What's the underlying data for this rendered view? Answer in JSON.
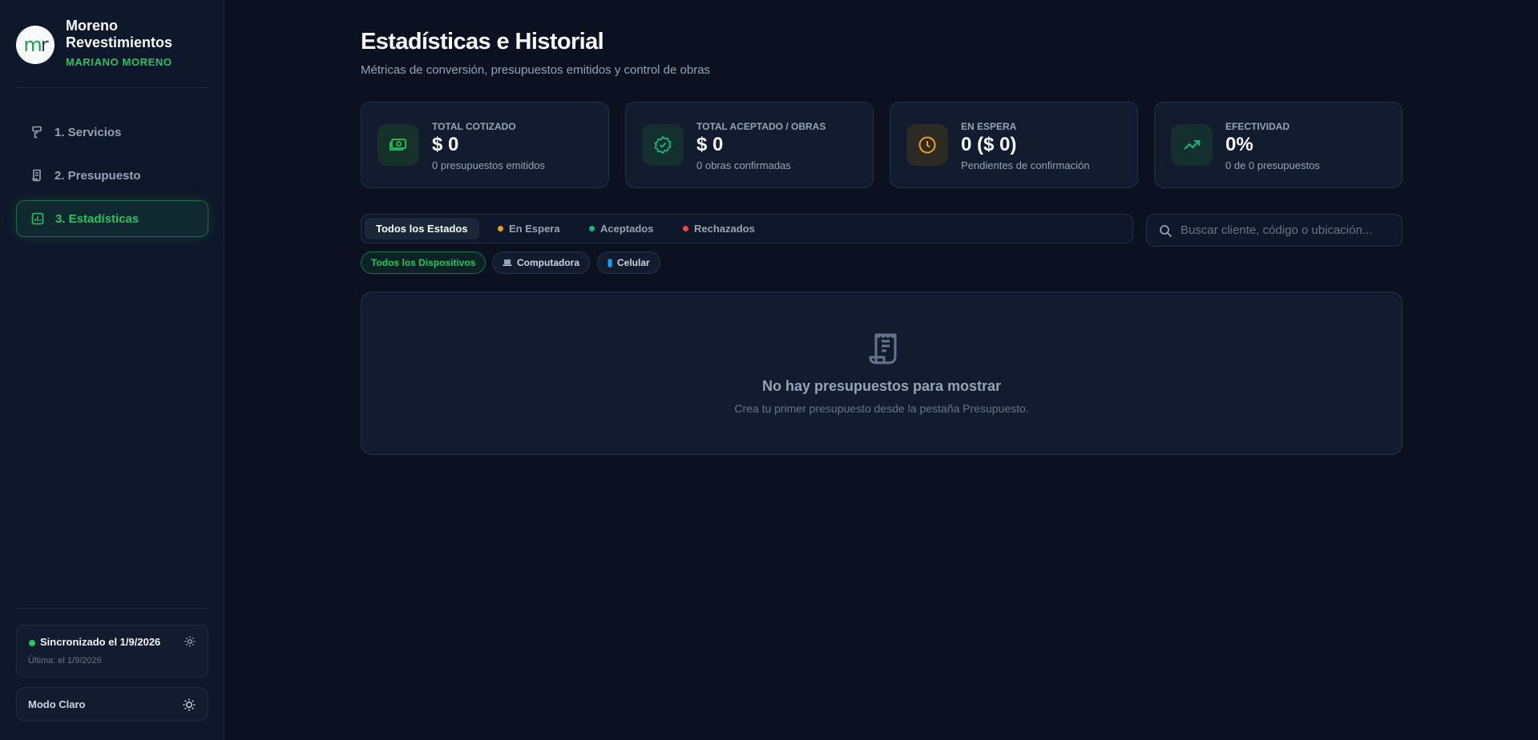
{
  "sidebar": {
    "brand_name": "Moreno Revestimientos",
    "brand_user": "MARIANO MORENO",
    "logo_text_m": "m",
    "logo_text_r": "r",
    "items": [
      {
        "label": "1. Servicios",
        "icon": "paint-roller-icon"
      },
      {
        "label": "2. Presupuesto",
        "icon": "receipt-icon"
      },
      {
        "label": "3. Estadísticas",
        "icon": "bar-chart-icon",
        "active": true
      }
    ],
    "sync": {
      "title": "Sincronizado el 1/9/2026",
      "subtitle": "Última: el 1/9/2026",
      "status_color": "#22c55e"
    },
    "theme_toggle": "Modo Claro"
  },
  "header": {
    "title": "Estadísticas e Historial",
    "subtitle": "Métricas de conversión, presupuestos emitidos y control de obras"
  },
  "cards": [
    {
      "label": "TOTAL COTIZADO",
      "value": "$ 0",
      "sub": "0 presupuestos emitidos",
      "icon": "cash-icon",
      "color": "#22c55e"
    },
    {
      "label": "TOTAL ACEPTADO / OBRAS",
      "value": "$ 0",
      "sub": "0 obras confirmadas",
      "icon": "verified-badge-icon",
      "color": "#10b981"
    },
    {
      "label": "EN ESPERA",
      "value": "0 ($ 0)",
      "sub": "Pendientes de confirmación",
      "icon": "clock-icon",
      "color": "#f59e0b"
    },
    {
      "label": "EFECTIVIDAD",
      "value": "0%",
      "sub": "0 de 0 presupuestos",
      "icon": "trending-up-icon",
      "color": "#10b981"
    }
  ],
  "status_filters": [
    {
      "label": "Todos los Estados",
      "active": true
    },
    {
      "label": "En Espera",
      "dot": "#f59e0b"
    },
    {
      "label": "Aceptados",
      "dot": "#10b981"
    },
    {
      "label": "Rechazados",
      "dot": "#ef4444"
    }
  ],
  "search": {
    "placeholder": "Buscar cliente, código o ubicación...",
    "value": ""
  },
  "device_filters": [
    {
      "label": "Todos los Dispositivos",
      "active": true
    },
    {
      "label": "Computadora",
      "icon": "laptop-icon"
    },
    {
      "label": "Celular",
      "icon": "phone-icon"
    }
  ],
  "empty_state": {
    "title": "No hay presupuestos para mostrar",
    "subtitle": "Crea tu primer presupuesto desde la pestaña Presupuesto."
  }
}
